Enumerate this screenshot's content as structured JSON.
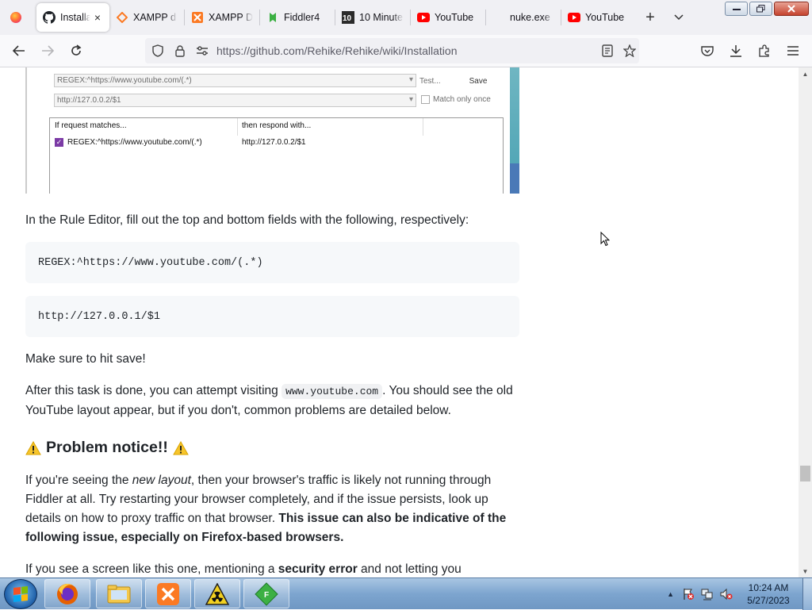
{
  "browser": {
    "tabs": [
      {
        "title": "Installa",
        "icon": "github-icon",
        "active": true
      },
      {
        "title": "XAMPP d",
        "icon": "xampp-orange-icon",
        "active": false
      },
      {
        "title": "XAMPP D",
        "icon": "xampp-icon",
        "active": false
      },
      {
        "title": "Fiddler4",
        "icon": "fiddler-icon",
        "active": false
      },
      {
        "title": "10 Minute",
        "icon": "10minute-icon",
        "active": false
      },
      {
        "title": "YouTube",
        "icon": "youtube-icon",
        "active": false
      },
      {
        "title": "nuke.exe",
        "icon": "blank-icon",
        "active": false
      },
      {
        "title": "YouTube",
        "icon": "youtube-icon",
        "active": false
      }
    ],
    "tab_close": "×",
    "new_tab": "+",
    "list_tabs": "⌵",
    "url": "https://github.com/Rehike/Rehike/wiki/Installation"
  },
  "embedded_screenshot": {
    "match_field": "REGEX:^https://www.youtube.com/(.*)",
    "respond_field": "http://127.0.0.2/$1",
    "test_label": "Test...",
    "save_label": "Save",
    "match_once_label": "Match only once",
    "col_if": "If request matches...",
    "col_then": "then respond with...",
    "row_match": "REGEX:^https://www.youtube.com/(.*)",
    "row_respond": "http://127.0.0.2/$1"
  },
  "article": {
    "p1": "In the Rule Editor, fill out the top and bottom fields with the following, respectively:",
    "code1": "REGEX:^https://www.youtube.com/(.*)",
    "code2": "http://127.0.0.1/$1",
    "p2": "Make sure to hit save!",
    "p3_a": "After this task is done, you can attempt visiting ",
    "p3_code": "www.youtube.com",
    "p3_b": ". You should see the old YouTube layout appear, but if you don't, common problems are detailed below.",
    "heading": "Problem notice!!",
    "p4_a": "If you're seeing the ",
    "p4_em": "new layout",
    "p4_b": ", then your browser's traffic is likely not running through Fiddler at all. Try restarting your browser completely, and if the issue persists, look up details on how to proxy traffic on that browser. ",
    "p4_strong": "This issue can also be indicative of the following issue, especially on Firefox-based browsers.",
    "p5_a": "If you see a screen like this one, mentioning a ",
    "p5_strong": "security error",
    "p5_b": " and not letting you"
  },
  "taskbar": {
    "time": "10:24 AM",
    "date": "5/27/2023",
    "items": [
      "firefox-icon",
      "explorer-icon",
      "xampp-icon",
      "nuke-icon",
      "fiddler-icon"
    ]
  },
  "colors": {
    "accent_check": "#7b3aa5",
    "youtube_red": "#ff0000",
    "xampp_orange": "#fb7a24",
    "fiddler_green": "#3cb043"
  }
}
